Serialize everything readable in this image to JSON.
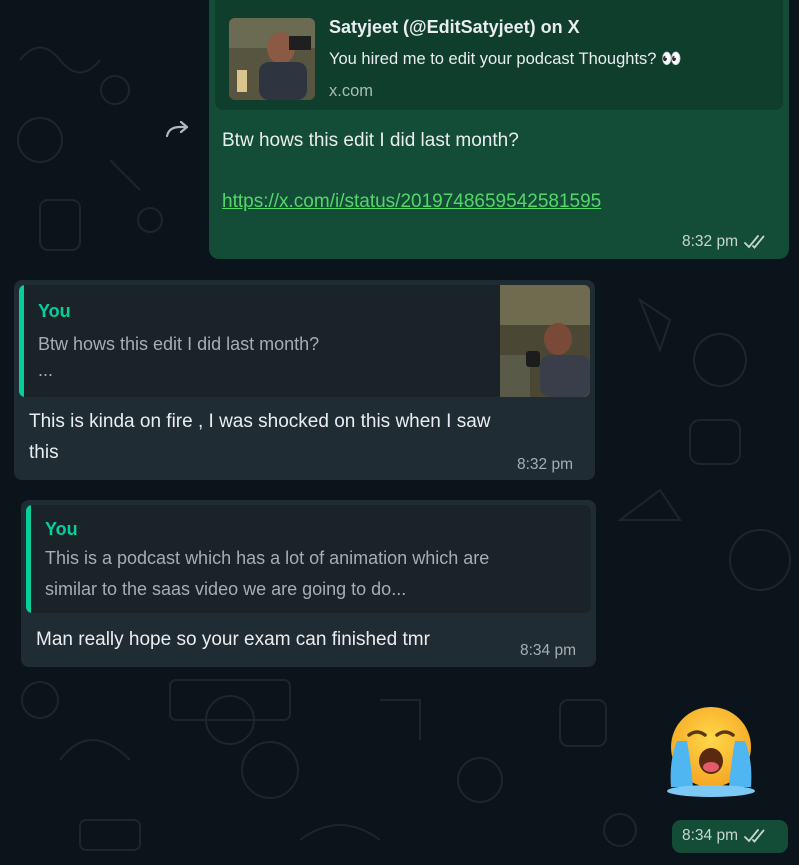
{
  "outgoing_message": {
    "link_preview": {
      "title": "Satyjeet (@EditSatyjeet) on X",
      "description": "You hired me to edit your podcast Thoughts?",
      "description_emoji": "👀",
      "domain": "x.com"
    },
    "text": "Btw hows this edit I did last month?",
    "link": "https://x.com/i/status/2019748659542581595",
    "time": "8:32 pm",
    "status": "read"
  },
  "reply_message_1": {
    "quote": {
      "author": "You",
      "text": "Btw hows this edit I did last month?",
      "more": "..."
    },
    "text_line1": "This is kinda on fire , I was shocked on this when I saw",
    "text_line2": "this",
    "time": "8:32 pm"
  },
  "reply_message_2": {
    "quote": {
      "author": "You",
      "text_line1": "This is a podcast which has a lot of animation which are",
      "text_line2": "similar to the saas video we are going to do..."
    },
    "text": "Man really hope so your exam can finished tmr",
    "time": "8:34 pm"
  },
  "emoji_message": {
    "emoji": "loudly-crying-face",
    "time": "8:34 pm",
    "status": "read"
  },
  "colors": {
    "chat_bg": "#0b141a",
    "outgoing_bubble": "#144d37",
    "incoming_bubble": "#202c33",
    "accent_green": "#06cf9c",
    "link_green": "#53d769"
  }
}
